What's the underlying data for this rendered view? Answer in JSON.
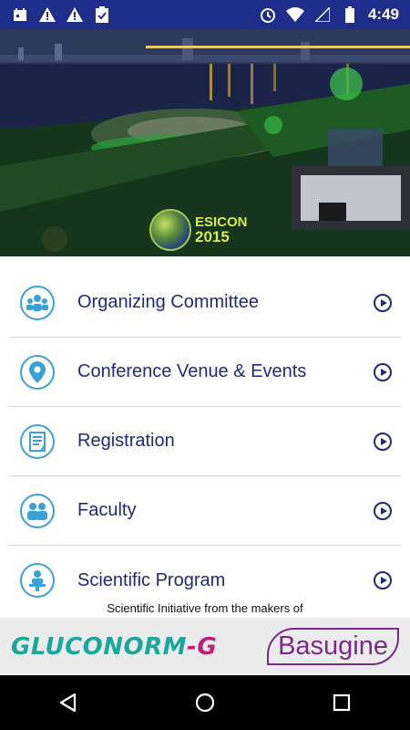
{
  "status_bar": {
    "time": "4:49",
    "left_icons": [
      "calendar-icon",
      "warning-icon",
      "warning-icon",
      "clipboard-check-icon"
    ],
    "right_icons": [
      "alarm-icon",
      "wifi-icon",
      "signal-icon",
      "battery-icon"
    ]
  },
  "banner": {
    "logo_name": "ESICON",
    "logo_year": "2015"
  },
  "menu": {
    "items": [
      {
        "label": "Organizing Committee",
        "icon": "committee-icon"
      },
      {
        "label": "Conference Venue & Events",
        "icon": "location-pin-icon"
      },
      {
        "label": "Registration",
        "icon": "registration-form-icon"
      },
      {
        "label": "Faculty",
        "icon": "faculty-people-icon"
      },
      {
        "label": "Scientific Program",
        "icon": "presenter-icon"
      }
    ]
  },
  "sponsor": {
    "line": "Scientific Initiative from the makers of",
    "brand1_main": "GLUCONORM",
    "brand1_suffix": "-G",
    "brand2": "Basugine"
  },
  "colors": {
    "status_bar": "#1f2e8a",
    "menu_text": "#1f2a7a",
    "icon_accent": "#3aa0d8"
  }
}
